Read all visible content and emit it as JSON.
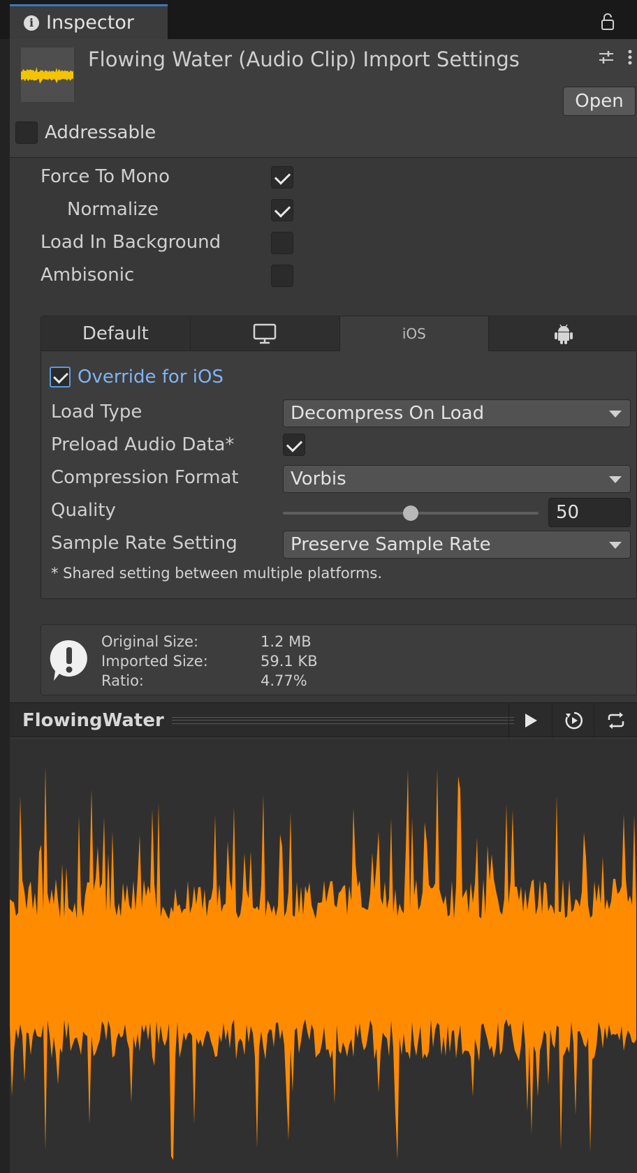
{
  "window": {
    "tab_title": "Inspector"
  },
  "header": {
    "title": "Flowing Water (Audio Clip) Import Settings",
    "open_label": "Open",
    "addressable_label": "Addressable",
    "addressable_checked": false
  },
  "properties": [
    {
      "label": "Force To Mono",
      "checked": true
    },
    {
      "label": "Normalize",
      "checked": true
    },
    {
      "label": "Load In Background",
      "checked": false
    },
    {
      "label": "Ambisonic",
      "checked": false
    }
  ],
  "platform_tabs": {
    "default_label": "Default",
    "standalone_icon": "monitor-icon",
    "ios_label": "iOS",
    "android_icon": "android-icon",
    "active": "iOS"
  },
  "ios_settings": {
    "override_label": "Override for iOS",
    "override_checked": true,
    "load_type_label": "Load Type",
    "load_type_value": "Decompress On Load",
    "preload_label": "Preload Audio Data*",
    "preload_checked": true,
    "compression_label": "Compression Format",
    "compression_value": "Vorbis",
    "quality_label": "Quality",
    "quality_value": "50",
    "quality_fraction": 0.5,
    "sample_rate_label": "Sample Rate Setting",
    "sample_rate_value": "Preserve Sample Rate",
    "note": "* Shared setting between multiple platforms."
  },
  "info": {
    "original_size_label": "Original Size:",
    "original_size_value": "1.2 MB",
    "imported_size_label": "Imported Size:",
    "imported_size_value": "59.1 KB",
    "ratio_label": "Ratio:",
    "ratio_value": "4.77%"
  },
  "preview": {
    "title": "FlowingWater",
    "waveform_color": "#ff8c00"
  },
  "colors": {
    "accent": "#3a79bb",
    "link": "#7fb4f5",
    "waveform": "#ff8c00"
  }
}
